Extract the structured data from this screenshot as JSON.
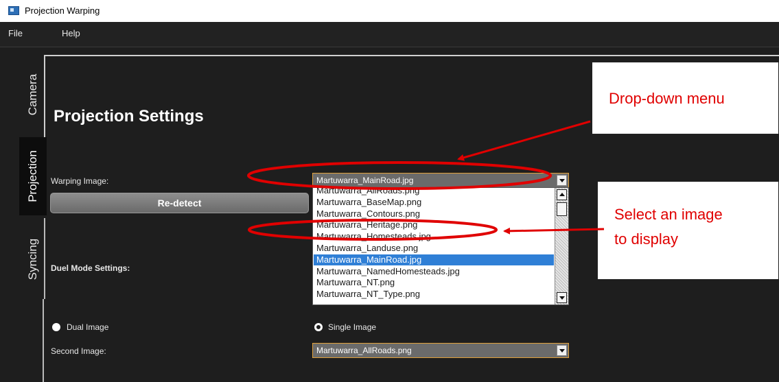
{
  "window": {
    "title": "Projection Warping"
  },
  "menu": {
    "file": "File",
    "help": "Help"
  },
  "tabs": {
    "camera": "Camera",
    "projection": "Projection",
    "syncing": "Syncing"
  },
  "page": {
    "heading": "Projection Settings",
    "warping_label": "Warping Image:",
    "warping_value": "Martuwarra_MainRoad.jpg",
    "redetect_label": "Re-detect",
    "duel_mode_label": "Duel Mode Settings:",
    "dual_image_label": "Dual Image",
    "single_image_label": "Single Image",
    "second_image_label": "Second Image:",
    "second_image_value": "Martuwarra_AllRoads.png"
  },
  "dropdown": {
    "items": [
      "Martuwarra_AllRoads.png",
      "Martuwarra_BaseMap.png",
      "Martuwarra_Contours.png",
      "Martuwarra_Heritage.png",
      "Martuwarra_Homesteads.jpg",
      "Martuwarra_Landuse.png",
      "Martuwarra_MainRoad.jpg",
      "Martuwarra_NamedHomesteads.jpg",
      "Martuwarra_NT.png",
      "Martuwarra_NT_Type.png"
    ],
    "selected_index": 6
  },
  "annotations": {
    "callout_dropdown": "Drop-down menu",
    "callout_select_1": "Select an image",
    "callout_select_2": "to display",
    "color": "#e00000"
  },
  "colors": {
    "accent": "#e1a13a",
    "selection": "#2f7fd6"
  }
}
